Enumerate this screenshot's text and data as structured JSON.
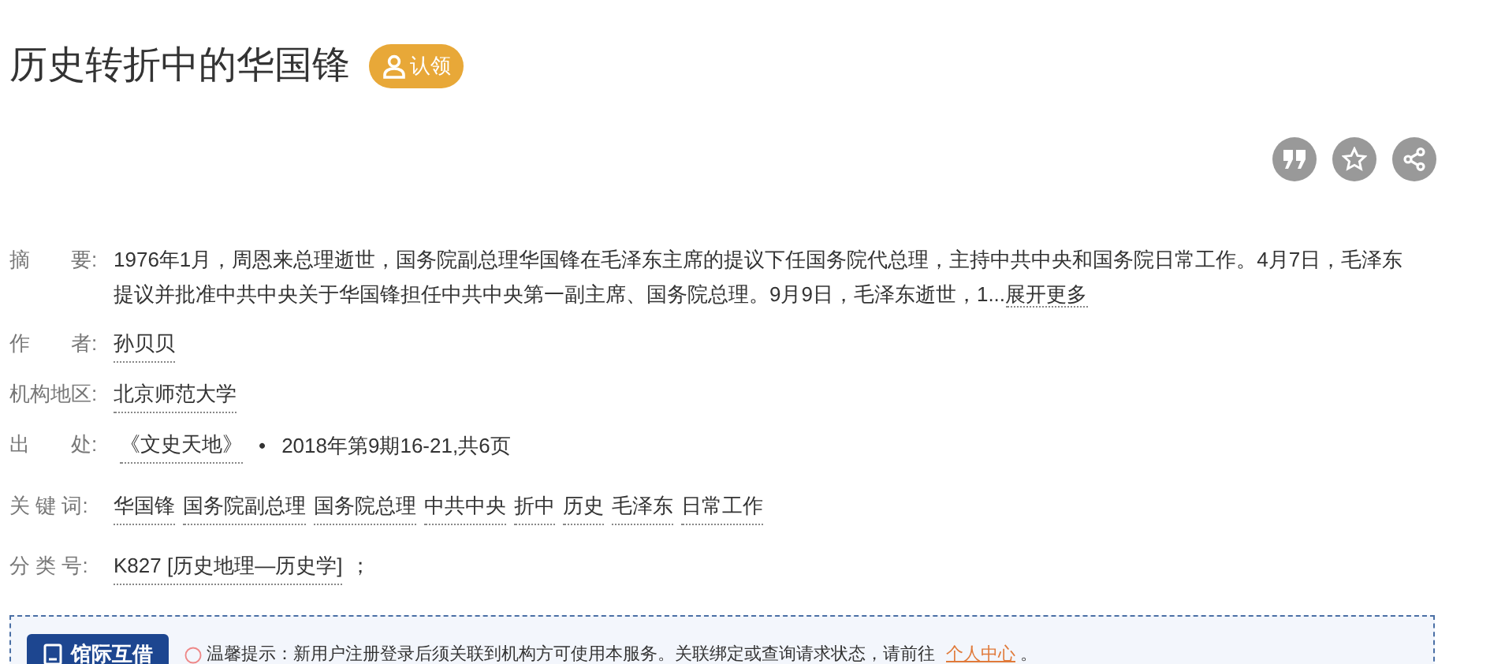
{
  "title": "历史转折中的华国锋",
  "claim_button": "认领",
  "fields": [
    {
      "kind": "abstract",
      "label": "摘　　要:",
      "text": "1976年1月，周恩来总理逝世，国务院副总理华国锋在毛泽东主席的提议下任国务院代总理，主持中共中央和国务院日常工作。4月7日，毛泽东提议并批准中共中央关于华国锋担任中共中央第一副主席、国务院总理。9月9日，毛泽东逝世，1...",
      "more": "展开更多"
    },
    {
      "kind": "links",
      "label": "作　　者:",
      "links": [
        "孙贝贝"
      ]
    },
    {
      "kind": "links",
      "label": "机构地区:",
      "links": [
        "北京师范大学"
      ]
    },
    {
      "kind": "source",
      "label": "出　　处:",
      "journal": "《文史天地》",
      "separator": "•",
      "detail": "2018年第9期16-21,共6页"
    },
    {
      "kind": "links",
      "label": "关 键 词:",
      "links": [
        "华国锋",
        "国务院副总理",
        "国务院总理",
        "中共中央",
        "折中",
        "历史",
        "毛泽东",
        "日常工作"
      ]
    },
    {
      "kind": "links",
      "label": "分 类 号:",
      "links": [
        "K827 [历史地理—历史学]"
      ],
      "suffix": "；"
    }
  ],
  "ill_box": {
    "button": "馆际互借",
    "hint": "温馨提示：新用户注册登录后须关联到机构方可使用本服务。关联绑定或查询请求状态，请前往",
    "link": "个人中心",
    "end": "。"
  }
}
